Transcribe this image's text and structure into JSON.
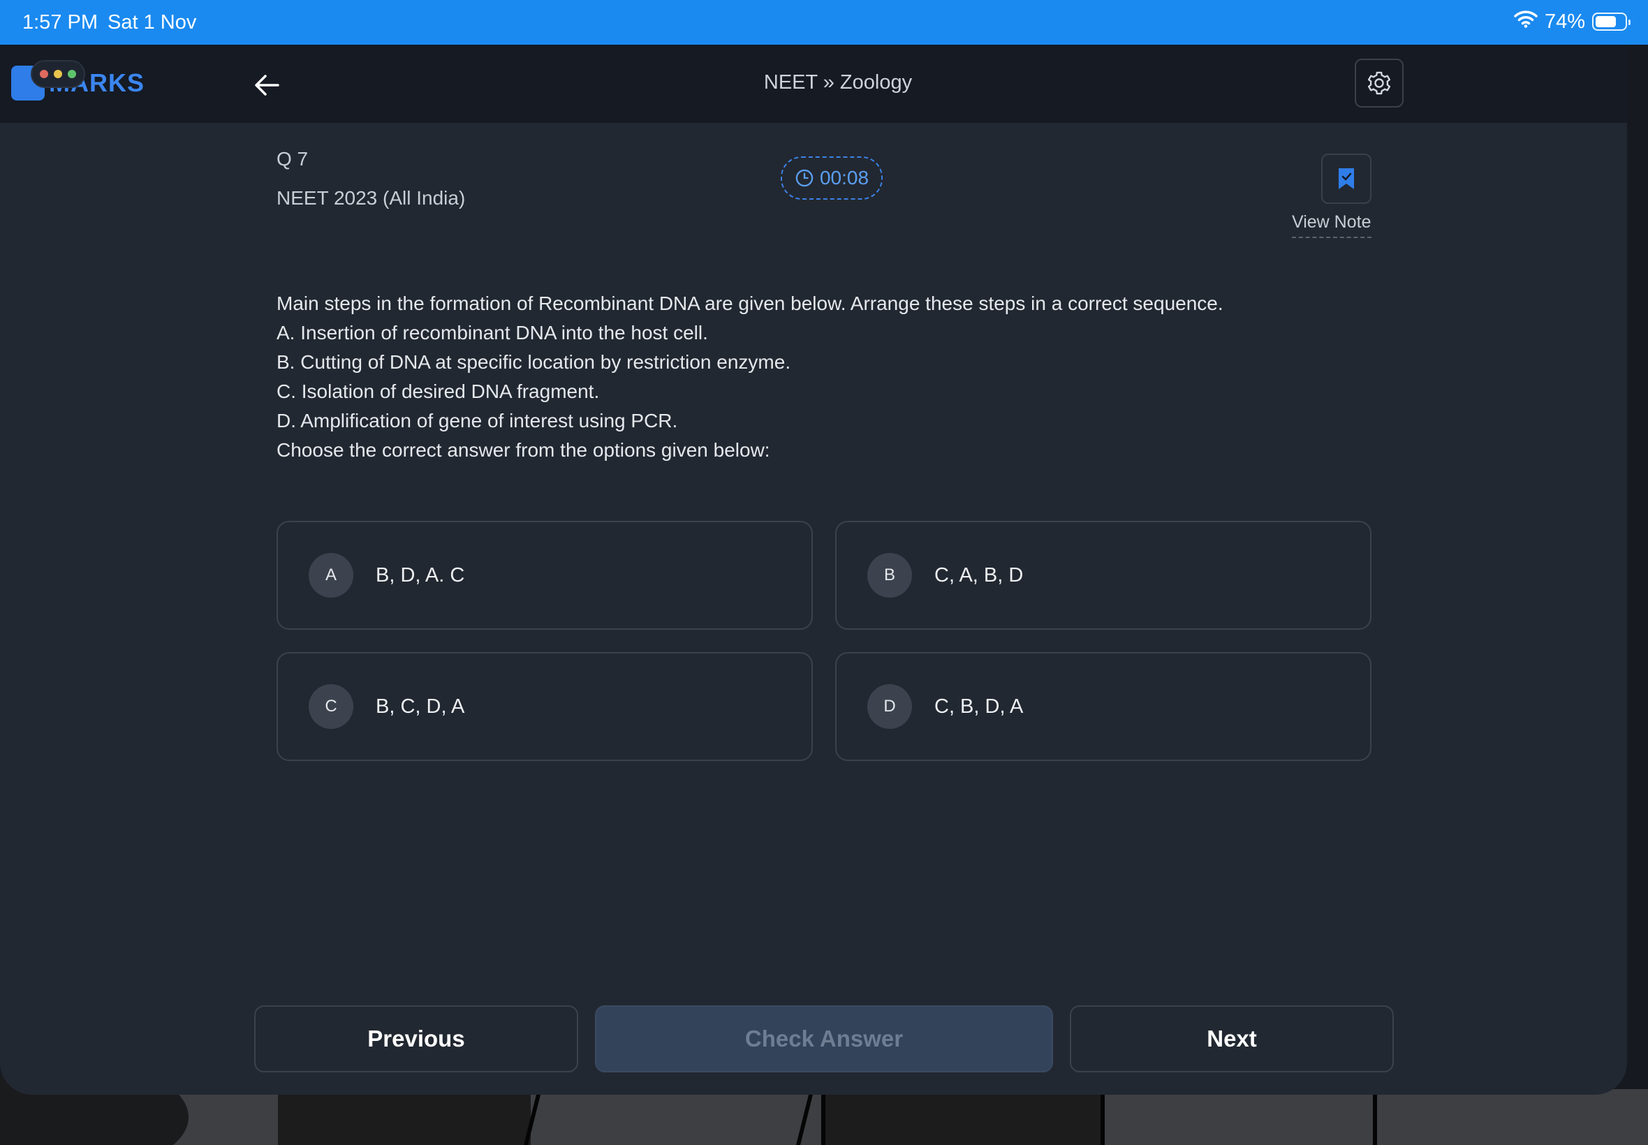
{
  "status_bar": {
    "time": "1:57 PM",
    "date": "Sat 1 Nov",
    "battery": "74%",
    "battery_level": 0.74
  },
  "app": {
    "logo_text": "MARKS",
    "breadcrumb": "NEET » Zoology"
  },
  "question": {
    "number": "Q 7",
    "source": "NEET 2023 (All India)",
    "timer": "00:08",
    "view_note": "View Note",
    "lines": [
      "Main steps in the formation of Recombinant DNA are given below. Arrange these steps in a correct sequence.",
      "A. Insertion of recombinant DNA into the host cell.",
      "B. Cutting of DNA at specific location by restriction enzyme.",
      "C. Isolation of desired DNA fragment.",
      "D. Amplification of gene of interest using PCR.",
      "Choose the correct answer from the options given below:"
    ]
  },
  "options": [
    {
      "letter": "A",
      "text": "B, D, A. C"
    },
    {
      "letter": "B",
      "text": "C, A, B, D"
    },
    {
      "letter": "C",
      "text": "B, C, D, A"
    },
    {
      "letter": "D",
      "text": "C, B, D, A"
    }
  ],
  "footer": {
    "previous": "Previous",
    "check": "Check Answer",
    "next": "Next"
  },
  "colors": {
    "status_bar": "#1a8af0",
    "accent": "#3b86f0",
    "window_bg": "#222831",
    "header_bg": "#151a23"
  },
  "icons": [
    "wifi-icon",
    "battery-icon",
    "back-arrow-icon",
    "gear-icon",
    "clock-icon",
    "bookmark-icon"
  ]
}
